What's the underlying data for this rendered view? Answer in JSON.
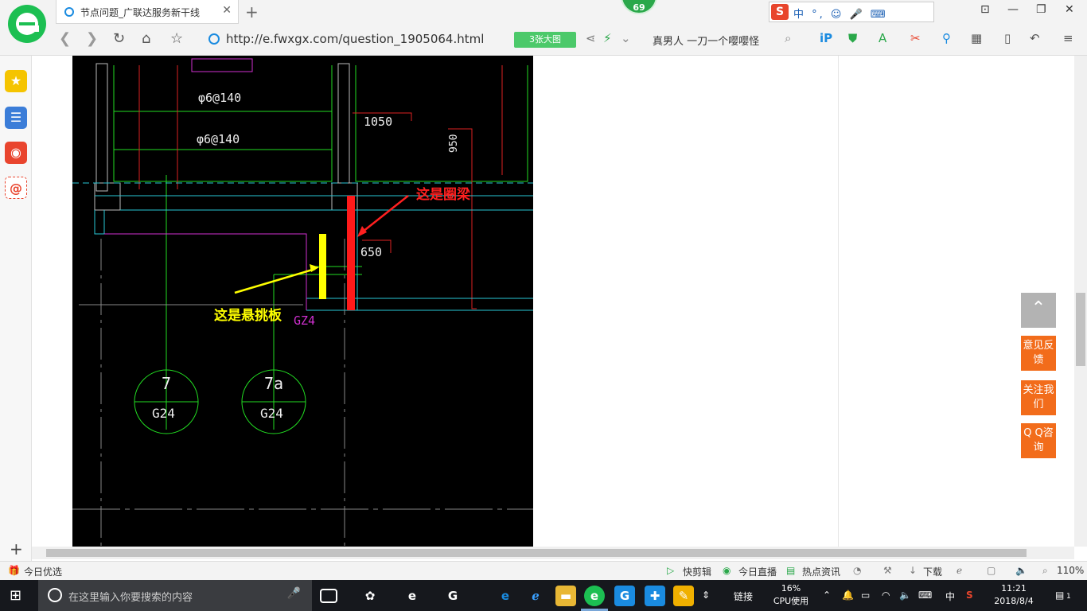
{
  "browser": {
    "tab_title": "节点问题_广联达服务新干线",
    "tab_close": "✕",
    "new_tab": "+",
    "badge_count": "69",
    "ime_logo": "S",
    "ime_status": "中 °, ☺ 🎤 ⌨",
    "window_controls": [
      "⊡",
      "—",
      "❐",
      "✕"
    ],
    "url": "http://e.fwxgx.com/question_1905064.html",
    "big_image_label": "3张大图",
    "search_text": "真男人 一刀一个嘤嘤怪",
    "nav": {
      "back": "❮",
      "forward": "❯",
      "refresh": "↻",
      "home": "⌂",
      "star": "☆"
    },
    "accent_color": "#1cbf52"
  },
  "sidebar": {
    "items": [
      {
        "icon": "star-icon",
        "glyph": "★",
        "color": "#f5c400"
      },
      {
        "icon": "news-icon",
        "glyph": "☰",
        "color": "#3b7dd8"
      },
      {
        "icon": "weibo-icon",
        "glyph": "◉",
        "color": "#e9452e"
      },
      {
        "icon": "mail-icon",
        "glyph": "@",
        "color": "#e9452e"
      }
    ],
    "add": "+"
  },
  "drawing": {
    "dim_labels": [
      "φ6@140",
      "φ6@140",
      "1050",
      "950",
      "650",
      "GZ4"
    ],
    "axis_labels": [
      {
        "top": "7",
        "bottom": "G24"
      },
      {
        "top": "7a",
        "bottom": "G24"
      }
    ],
    "annotation_beam": "这是圈梁",
    "annotation_board": "这是悬挑板",
    "beam_color": "#ff1a1a",
    "board_color": "#ffff00"
  },
  "float_buttons": {
    "top": "⌃",
    "feedback": "意见反馈",
    "follow": "关注我们",
    "qq": "Q Q咨询",
    "accent_color": "#f26c1b"
  },
  "statusbar": {
    "left": "今日优选",
    "items": [
      "快剪辑",
      "今日直播",
      "热点资讯",
      "下载"
    ],
    "zoom": "110%"
  },
  "taskbar": {
    "search_placeholder": "在这里输入你要搜索的内容",
    "link_label": "链接",
    "cpu_percent": "16%",
    "cpu_label": "CPU使用",
    "ime": "中",
    "time": "11:21",
    "date": "2018/8/4",
    "notify_count": "1"
  }
}
